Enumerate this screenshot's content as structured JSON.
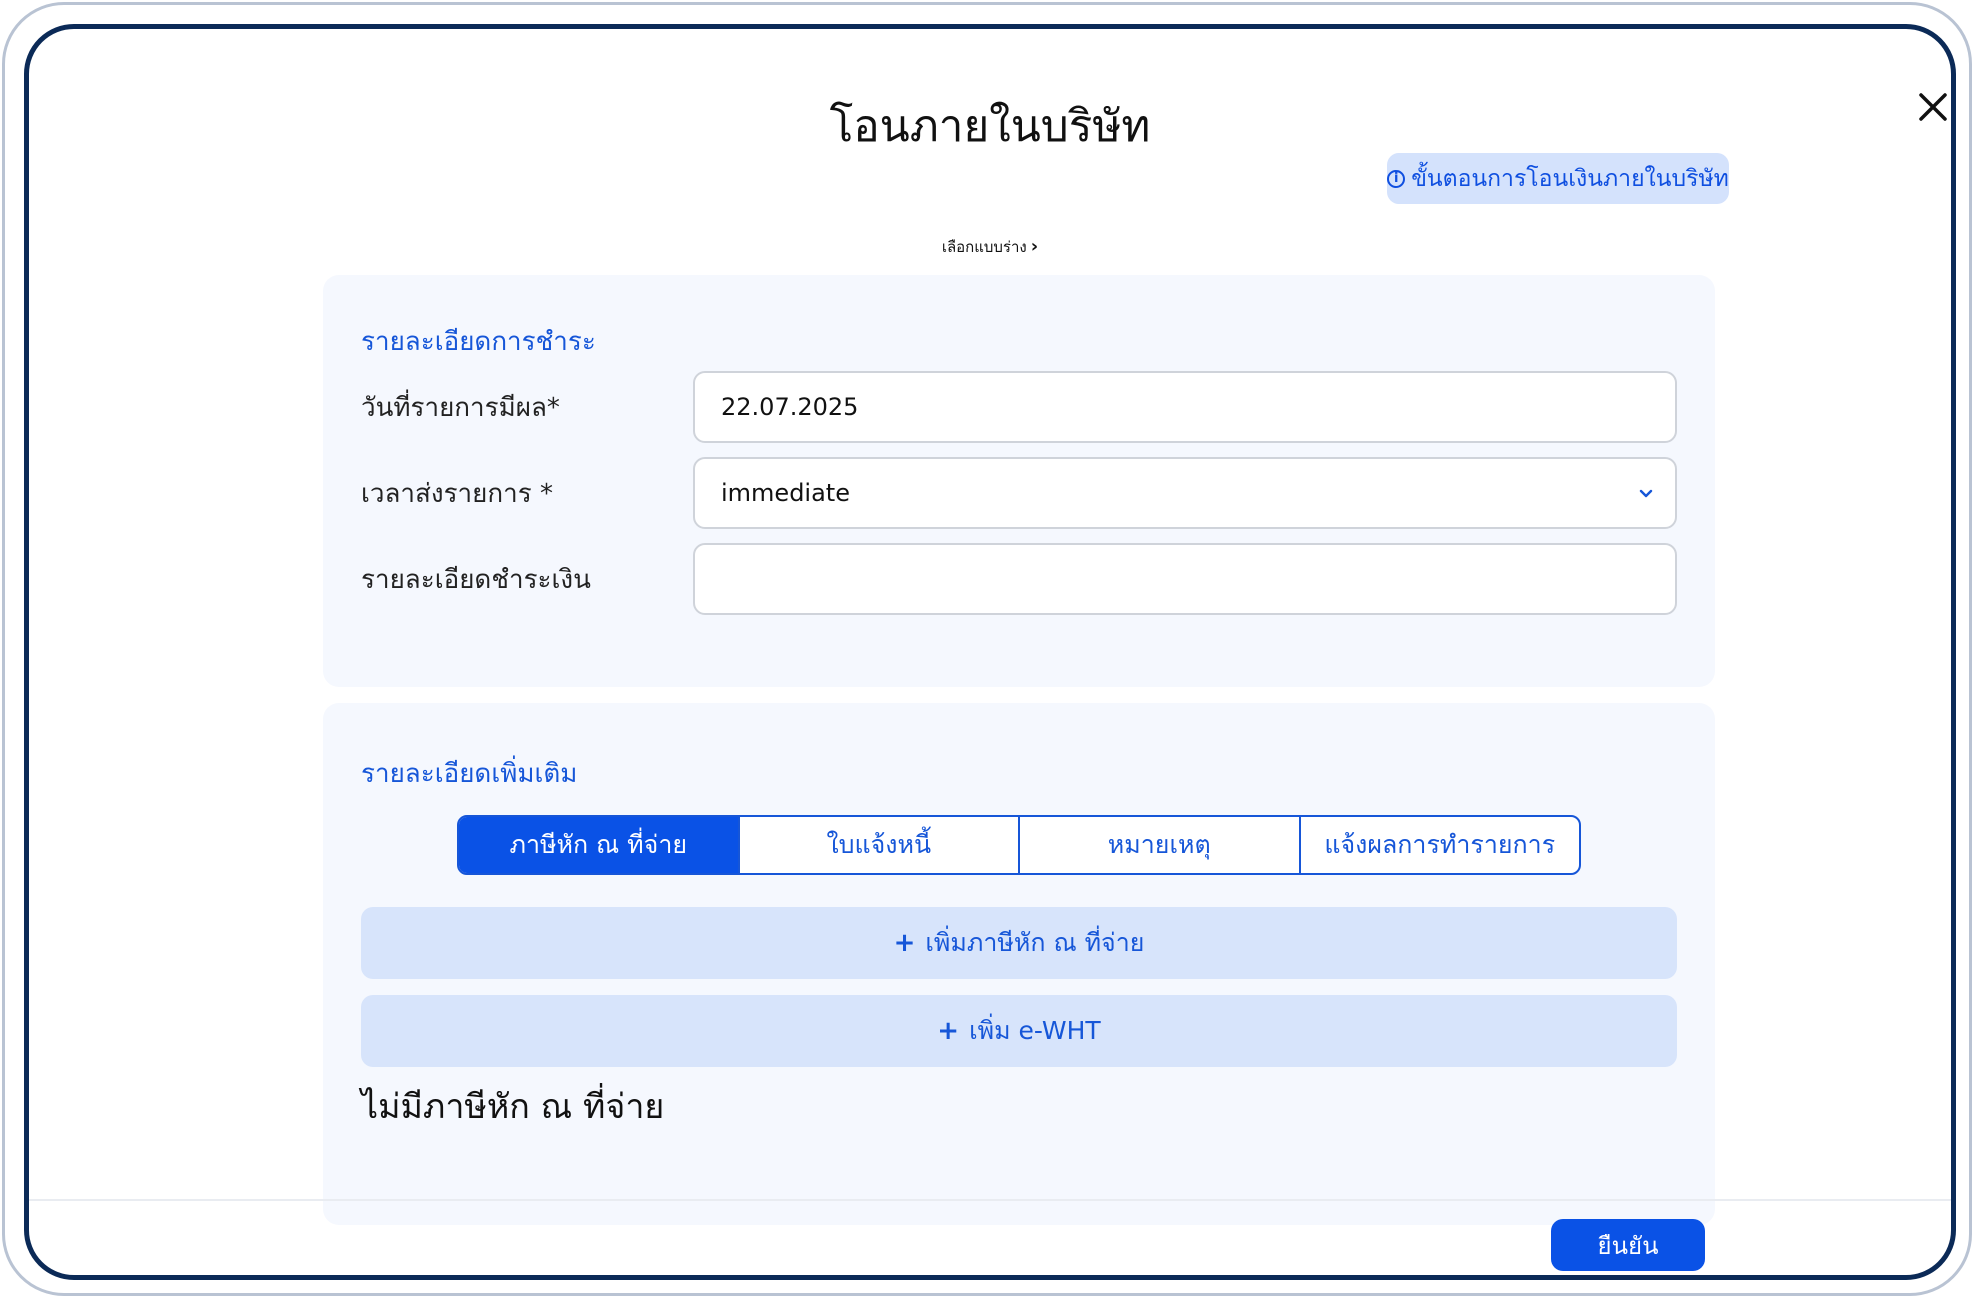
{
  "modal": {
    "title": "โอนภายในบริษัท",
    "help_button": "ขั้นตอนการโอนเงินภายในบริษัท",
    "template_link": "เลือกแบบร่าง",
    "confirm_button": "ยืนยัน"
  },
  "payment_details": {
    "section_title": "รายละเอียดการชำระ",
    "effective_date_label": "วันที่รายการมีผล*",
    "effective_date_value": "22.07.2025",
    "send_time_label": "เวลาส่งรายการ *",
    "send_time_value": "immediate",
    "payment_detail_label": "รายละเอียดชำระเงิน",
    "payment_detail_value": ""
  },
  "additional_details": {
    "section_title": "รายละเอียดเพิ่มเติม",
    "tabs": [
      {
        "label": "ภาษีหัก ณ ที่จ่าย",
        "active": true
      },
      {
        "label": "ใบแจ้งหนี้",
        "active": false
      },
      {
        "label": "หมายเหตุ",
        "active": false
      },
      {
        "label": "แจ้งผลการทำรายการ",
        "active": false
      }
    ],
    "add_wht_button": "เพิ่มภาษีหัก ณ ที่จ่าย",
    "add_ewht_button": "เพิ่ม e-WHT",
    "empty_text": "ไม่มีภาษีหัก ณ ที่จ่าย"
  },
  "colors": {
    "primary": "#0a52e6",
    "accent_text": "#1656d8",
    "panel_bg": "#f5f8fe",
    "light_button_bg": "#d7e4fb",
    "modal_border": "#0b2a57"
  }
}
